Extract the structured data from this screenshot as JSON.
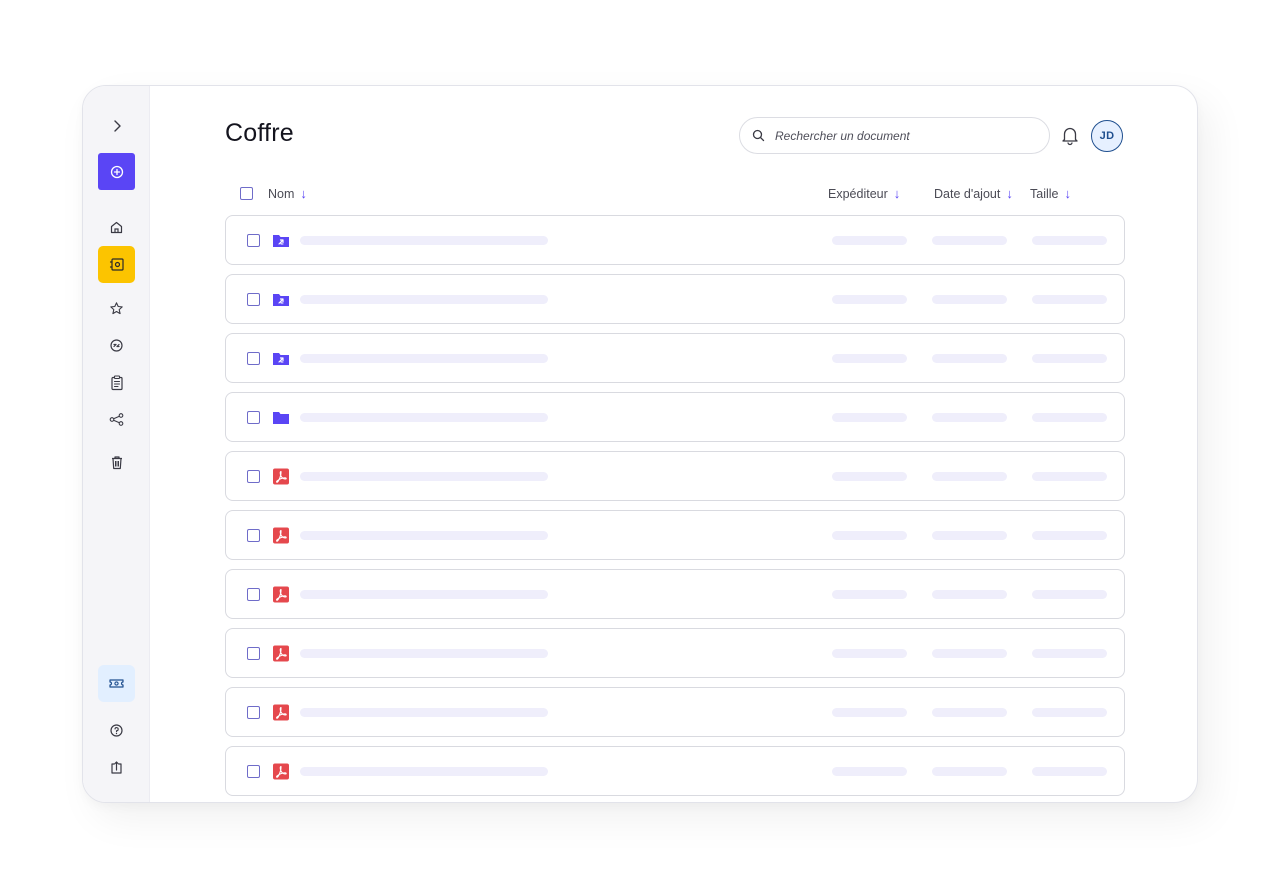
{
  "page_title": "Coffre",
  "search": {
    "placeholder": "Rechercher un document"
  },
  "user": {
    "initials": "JD"
  },
  "colors": {
    "accent": "#5a45f5",
    "vault_active": "#fcc400",
    "pdf_red": "#e5484d",
    "skeleton": "#efeefb"
  },
  "sidebar": {
    "items": [
      {
        "name": "expand",
        "icon": "chevron-right-icon"
      },
      {
        "name": "add",
        "icon": "plus-circle-icon"
      },
      {
        "name": "home",
        "icon": "home-icon"
      },
      {
        "name": "vault",
        "icon": "vault-icon",
        "active": true
      },
      {
        "name": "favorites",
        "icon": "star-icon"
      },
      {
        "name": "sync",
        "icon": "sync-icon"
      },
      {
        "name": "clipboard",
        "icon": "clipboard-icon"
      },
      {
        "name": "share",
        "icon": "share-icon"
      },
      {
        "name": "trash",
        "icon": "trash-icon"
      },
      {
        "name": "ticket",
        "icon": "ticket-icon"
      },
      {
        "name": "help",
        "icon": "help-icon"
      },
      {
        "name": "logout",
        "icon": "logout-icon"
      }
    ]
  },
  "table": {
    "columns": [
      {
        "label": "Nom",
        "sort": "↓"
      },
      {
        "label": "Expéditeur",
        "sort": "↓"
      },
      {
        "label": "Date d'ajout",
        "sort": "↓"
      },
      {
        "label": "Taille",
        "sort": "↓"
      }
    ],
    "rows": [
      {
        "type": "shared-folder"
      },
      {
        "type": "shared-folder"
      },
      {
        "type": "shared-folder"
      },
      {
        "type": "folder"
      },
      {
        "type": "pdf"
      },
      {
        "type": "pdf"
      },
      {
        "type": "pdf"
      },
      {
        "type": "pdf"
      },
      {
        "type": "pdf"
      },
      {
        "type": "pdf"
      }
    ]
  }
}
